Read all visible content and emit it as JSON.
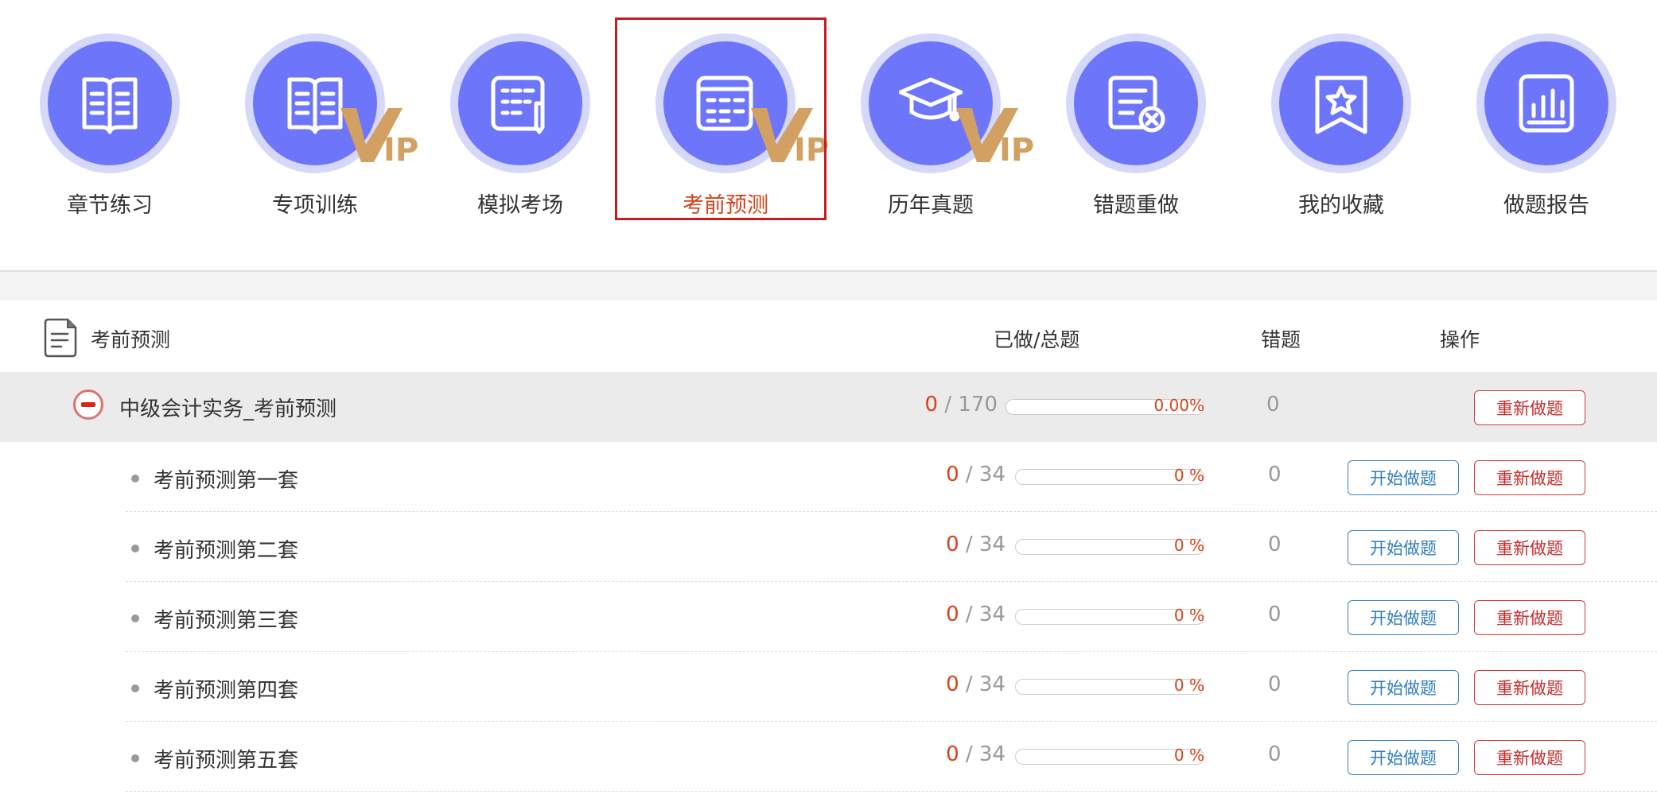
{
  "nav": {
    "items": [
      {
        "label": "章节练习",
        "icon": "book-icon",
        "vip": false
      },
      {
        "label": "专项训练",
        "icon": "book-icon",
        "vip": true
      },
      {
        "label": "模拟考场",
        "icon": "exam-sheet-icon",
        "vip": false
      },
      {
        "label": "考前预测",
        "icon": "calendar-list-icon",
        "vip": true,
        "active": true
      },
      {
        "label": "历年真题",
        "icon": "graduation-cap-icon",
        "vip": true
      },
      {
        "label": "错题重做",
        "icon": "wrong-question-icon",
        "vip": false
      },
      {
        "label": "我的收藏",
        "icon": "star-bookmark-icon",
        "vip": false
      },
      {
        "label": "做题报告",
        "icon": "bar-report-icon",
        "vip": false
      }
    ],
    "vip_text": "IP",
    "colors": {
      "circle": "#6d76fb",
      "ring": "#d6d8fb",
      "vip": "#d2a062",
      "active_label": "#d9411a",
      "active_border": "#c81b1b"
    }
  },
  "table": {
    "header": {
      "title": "考前预测",
      "col_progress": "已做/总题",
      "col_wrong": "错题",
      "col_action": "操作"
    },
    "group": {
      "title": "中级会计实务_考前预测",
      "done": "0",
      "sep": " / ",
      "total": "170",
      "percent": "0.00%",
      "progress_fraction": 0,
      "wrong": "0",
      "redo_label": "重新做题"
    },
    "rows": [
      {
        "title": "考前预测第一套",
        "done": "0",
        "sep": " / ",
        "total": "34",
        "percent": "0 %",
        "progress_fraction": 0,
        "wrong": "0",
        "start_label": "开始做题",
        "redo_label": "重新做题"
      },
      {
        "title": "考前预测第二套",
        "done": "0",
        "sep": " / ",
        "total": "34",
        "percent": "0 %",
        "progress_fraction": 0,
        "wrong": "0",
        "start_label": "开始做题",
        "redo_label": "重新做题"
      },
      {
        "title": "考前预测第三套",
        "done": "0",
        "sep": " / ",
        "total": "34",
        "percent": "0 %",
        "progress_fraction": 0,
        "wrong": "0",
        "start_label": "开始做题",
        "redo_label": "重新做题"
      },
      {
        "title": "考前预测第四套",
        "done": "0",
        "sep": " / ",
        "total": "34",
        "percent": "0 %",
        "progress_fraction": 0,
        "wrong": "0",
        "start_label": "开始做题",
        "redo_label": "重新做题"
      },
      {
        "title": "考前预测第五套",
        "done": "0",
        "sep": " / ",
        "total": "34",
        "percent": "0 %",
        "progress_fraction": 0,
        "wrong": "0",
        "start_label": "开始做题",
        "redo_label": "重新做题"
      }
    ]
  }
}
